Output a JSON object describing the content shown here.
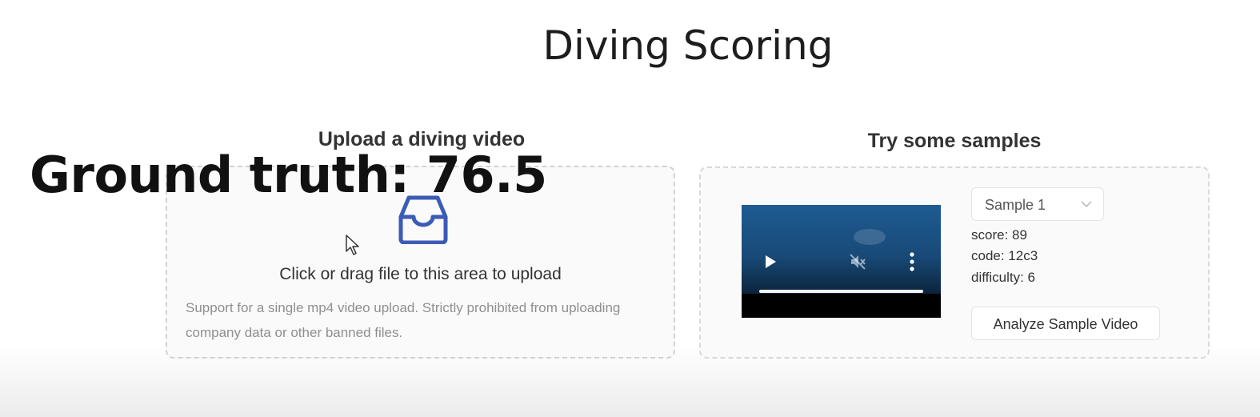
{
  "page": {
    "title": "Diving Scoring",
    "overlay_text": "Ground truth: 76.5"
  },
  "upload": {
    "heading": "Upload a diving video",
    "dropzone_text": "Click or drag file to this area to upload",
    "hint": "Support for a single mp4 video upload. Strictly prohibited from uploading company data or other banned files.",
    "icon": "inbox-icon"
  },
  "samples": {
    "heading": "Try some samples",
    "select_value": "Sample 1",
    "score": "score: 89",
    "code": "code: 12c3",
    "difficulty": "difficulty: 6",
    "analyze_label": "Analyze Sample Video"
  },
  "colors": {
    "icon_blue": "#3b5bb5",
    "border": "#d2d2d2",
    "hint_gray": "#8f8f8f"
  }
}
